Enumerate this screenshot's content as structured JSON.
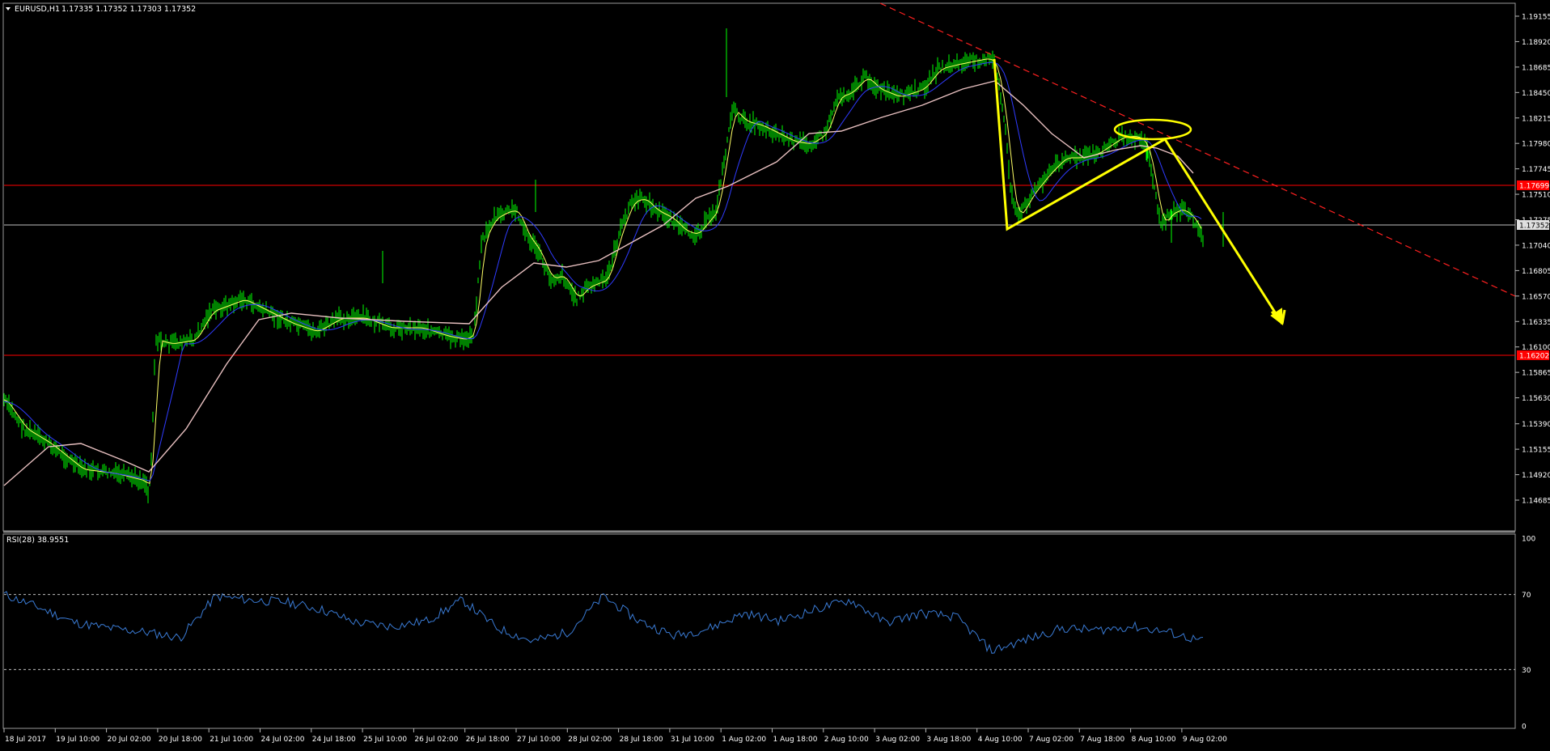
{
  "header": {
    "symbol": "EURUSD,H1",
    "ohlc": "1.17335 1.17352 1.17303 1.17352"
  },
  "indicator": {
    "label": "RSI(28) 38.9551",
    "levels": [
      100,
      70,
      30,
      0
    ]
  },
  "price_axis": {
    "ticks": [
      "1.19155",
      "1.18920",
      "1.18685",
      "1.18450",
      "1.18215",
      "1.17980",
      "1.17745",
      "1.17510",
      "1.17275",
      "1.17040",
      "1.16805",
      "1.16570",
      "1.16335",
      "1.16100",
      "1.15865",
      "1.15630",
      "1.15390",
      "1.15155",
      "1.14920",
      "1.14685"
    ],
    "current_price": "1.17352",
    "resistance_label": "1.17699",
    "support_label": "1.16202"
  },
  "time_axis": {
    "labels": [
      "18 Jul 2017",
      "19 Jul 10:00",
      "20 Jul 02:00",
      "20 Jul 18:00",
      "21 Jul 10:00",
      "24 Jul 02:00",
      "24 Jul 18:00",
      "25 Jul 10:00",
      "26 Jul 02:00",
      "26 Jul 18:00",
      "27 Jul 10:00",
      "28 Jul 02:00",
      "28 Jul 18:00",
      "31 Jul 10:00",
      "1 Aug 02:00",
      "1 Aug 18:00",
      "2 Aug 10:00",
      "3 Aug 02:00",
      "3 Aug 18:00",
      "4 Aug 10:00",
      "7 Aug 02:00",
      "7 Aug 18:00",
      "8 Aug 10:00",
      "9 Aug 02:00"
    ]
  },
  "colors": {
    "candles": "#00ff00",
    "ma_fast": "#ffff66",
    "ma_mid": "#2f3bff",
    "ma_slow": "#e8c0c0",
    "levels": "#ff0000",
    "current": "#c0c0c0",
    "rsi": "#3a7bd5",
    "annotation": "#ffff00",
    "trendline": "#ff2020"
  },
  "chart_data": {
    "type": "line",
    "series": [
      {
        "x": [
          "18 Jul 2017",
          "19 Jul 10:00",
          "20 Jul 02:00",
          "20 Jul 18:00",
          "21 Jul 10:00",
          "24 Jul 02:00",
          "24 Jul 18:00",
          "25 Jul 10:00",
          "26 Jul 02:00",
          "26 Jul 18:00",
          "27 Jul 10:00",
          "28 Jul 02:00",
          "28 Jul 18:00",
          "31 Jul 10:00",
          "1 Aug 02:00",
          "1 Aug 18:00",
          "2 Aug 10:00",
          "3 Aug 02:00",
          "3 Aug 18:00",
          "4 Aug 10:00",
          "7 Aug 02:00",
          "7 Aug 18:00",
          "8 Aug 10:00",
          "9 Aug 02:00"
        ],
        "values": [
          1.1565,
          1.1525,
          1.1515,
          1.163,
          1.165,
          1.1665,
          1.165,
          1.164,
          1.164,
          1.174,
          1.168,
          1.166,
          1.174,
          1.173,
          1.1835,
          1.181,
          1.183,
          1.1855,
          1.188,
          1.174,
          1.179,
          1.179,
          1.181,
          1.1735
        ]
      }
    ],
    "ylim": [
      1.14685,
      1.19155
    ],
    "horizontal_levels": [
      1.17699,
      1.16202
    ]
  },
  "rsi_data": {
    "ylim": [
      0,
      100
    ],
    "values": [
      70,
      63,
      55,
      52,
      50,
      47,
      69,
      67,
      66,
      62,
      55,
      53,
      56,
      67,
      52,
      45,
      50,
      69,
      56,
      48,
      52,
      60,
      56,
      62,
      67,
      55,
      60,
      58,
      40,
      46,
      52,
      51,
      53,
      50,
      45
    ]
  }
}
